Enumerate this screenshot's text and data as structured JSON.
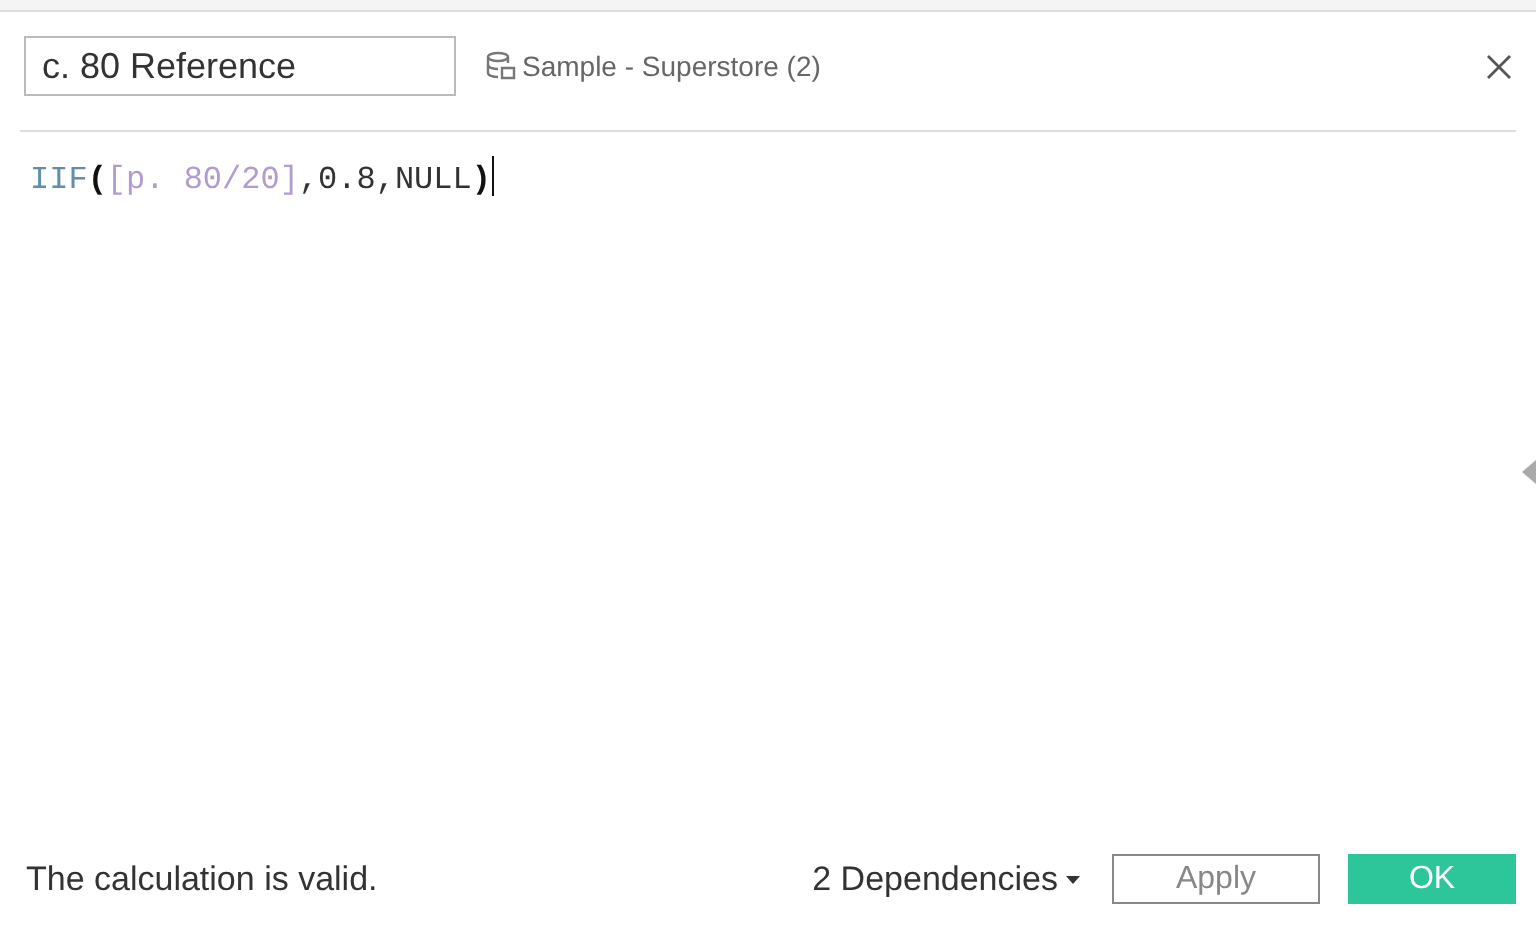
{
  "name_field": {
    "value": "c. 80 Reference"
  },
  "data_source": {
    "label": "Sample - Superstore (2)"
  },
  "formula": [
    {
      "kind": "function",
      "text": "IIF"
    },
    {
      "kind": "paren",
      "text": "("
    },
    {
      "kind": "field",
      "text": "[p. 80/20]"
    },
    {
      "kind": "plain",
      "text": ",0.8,NULL"
    },
    {
      "kind": "paren",
      "text": ")"
    }
  ],
  "status": "The calculation is valid.",
  "dependencies": "2 Dependencies",
  "buttons": [
    {
      "kind": "secondary",
      "label": "Apply"
    },
    {
      "kind": "primary",
      "label": "OK"
    }
  ]
}
